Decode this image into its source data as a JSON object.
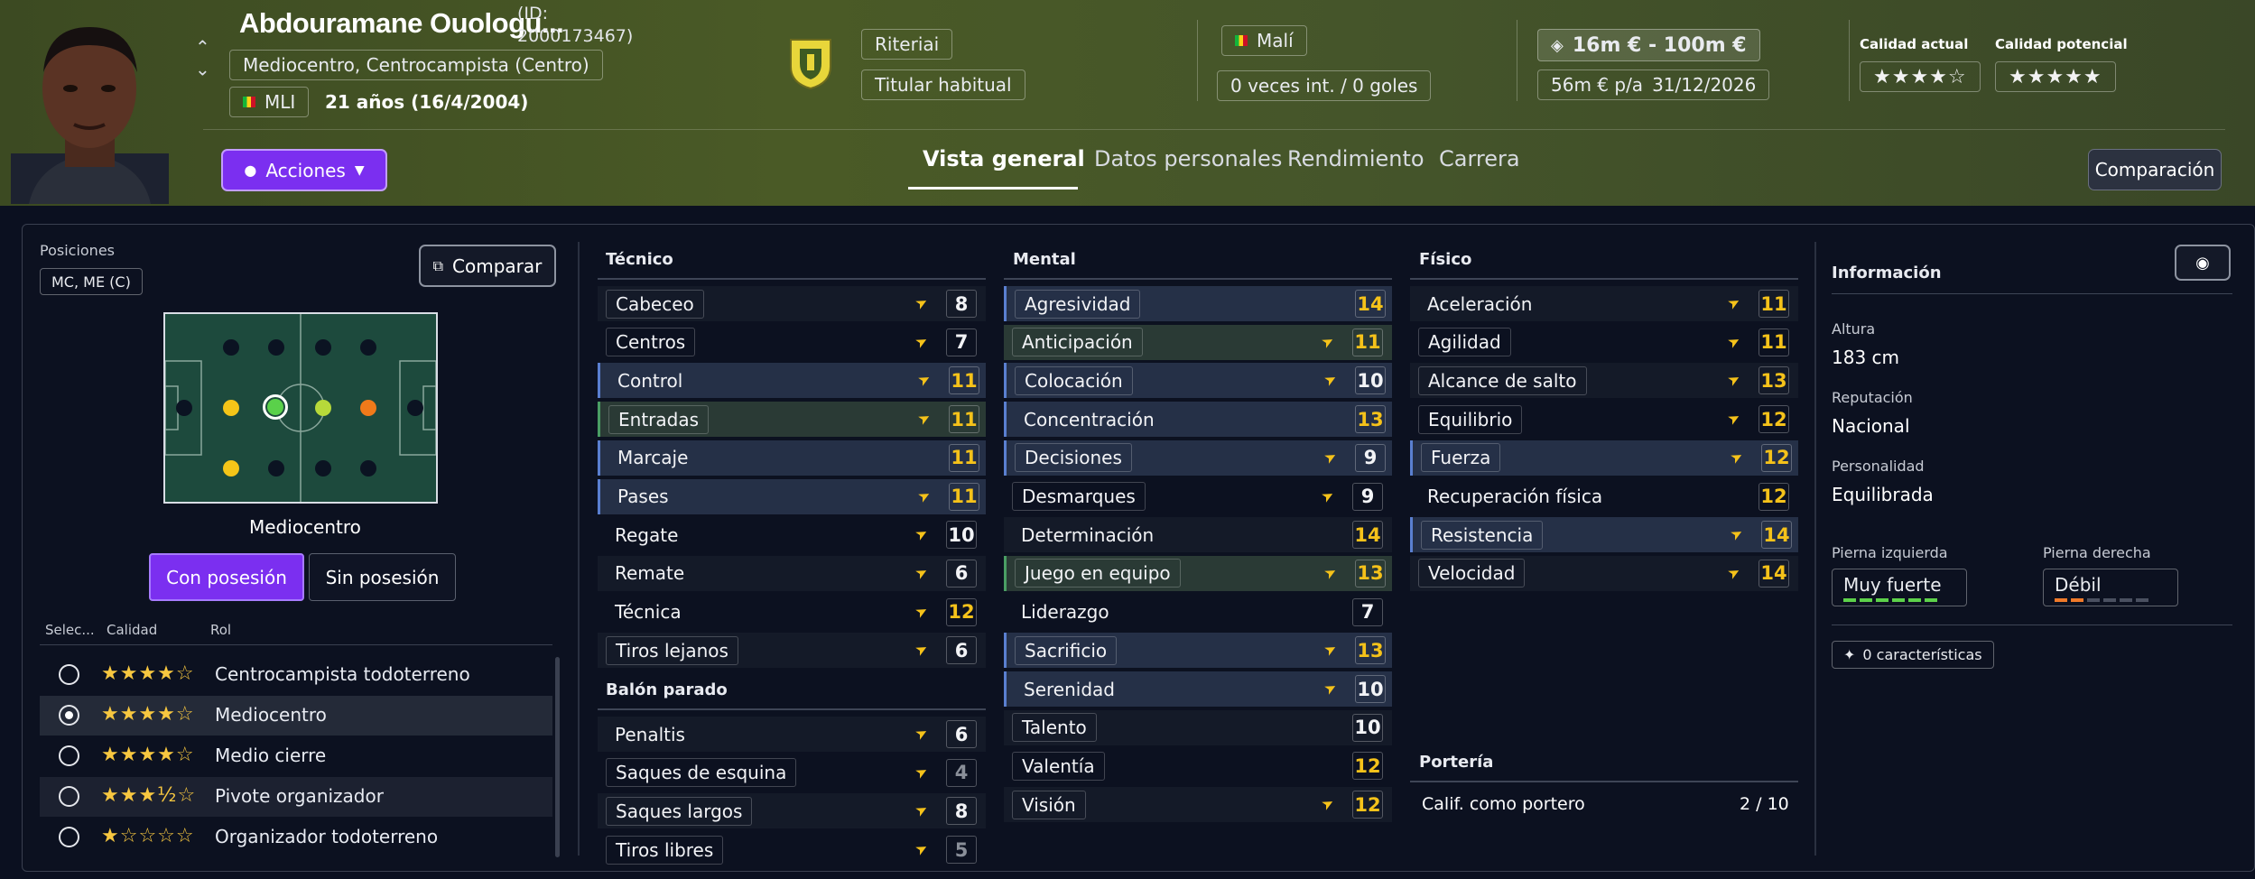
{
  "header": {
    "player_name": "Abdouramane Ouologu...",
    "player_id": "(ID: 2000173467)",
    "position_text": "Mediocentro, Centrocampista (Centro)",
    "nation_code": "MLI",
    "age_text": "21 años (16/4/2004)",
    "club": "Riteriai",
    "squad_status": "Titular habitual",
    "nationality": "Malí",
    "caps": "0 veces int. / 0 goles",
    "value_range": "16m € - 100m €",
    "wage": "56m € p/a",
    "contract_end": "31/12/2026",
    "current_ability_label": "Calidad actual",
    "current_ability_stars": "★★★★☆",
    "potential_ability_label": "Calidad potencial",
    "potential_ability_stars": "★★★★★",
    "actions_label": "Acciones",
    "compare_button": "Comparación"
  },
  "tabs": [
    "Vista general",
    "Datos personales",
    "Rendimiento",
    "Carrera"
  ],
  "positions": {
    "label": "Posiciones",
    "value": "MC, ME (C)",
    "compare_button": "Comparar",
    "role_name": "Mediocentro",
    "toggle_with": "Con posesión",
    "toggle_without": "Sin posesión",
    "col_select": "Selec...",
    "col_quality": "Calidad",
    "col_role": "Rol",
    "roles": [
      {
        "stars": "★★★★☆",
        "name": "Centrocampista todoterreno",
        "selected": false
      },
      {
        "stars": "★★★★☆",
        "name": "Mediocentro",
        "selected": true
      },
      {
        "stars": "★★★★☆",
        "name": "Medio cierre",
        "selected": false
      },
      {
        "stars": "★★★½☆",
        "name": "Pivote organizador",
        "selected": false
      },
      {
        "stars": "★☆☆☆☆",
        "name": "Organizador todoterreno",
        "selected": false
      }
    ]
  },
  "tecnico": {
    "title": "Técnico",
    "items": [
      {
        "name": "Cabeceo",
        "value": "8"
      },
      {
        "name": "Centros",
        "value": "7"
      },
      {
        "name": "Control",
        "value": "11"
      },
      {
        "name": "Entradas",
        "value": "11"
      },
      {
        "name": "Marcaje",
        "value": "11"
      },
      {
        "name": "Pases",
        "value": "11"
      },
      {
        "name": "Regate",
        "value": "10"
      },
      {
        "name": "Remate",
        "value": "6"
      },
      {
        "name": "Técnica",
        "value": "12"
      },
      {
        "name": "Tiros lejanos",
        "value": "6"
      }
    ]
  },
  "balon_parado": {
    "title": "Balón parado",
    "items": [
      {
        "name": "Penaltis",
        "value": "6"
      },
      {
        "name": "Saques de esquina",
        "value": "4"
      },
      {
        "name": "Saques largos",
        "value": "8"
      },
      {
        "name": "Tiros libres",
        "value": "5"
      }
    ]
  },
  "mental": {
    "title": "Mental",
    "items": [
      {
        "name": "Agresividad",
        "value": "14"
      },
      {
        "name": "Anticipación",
        "value": "11"
      },
      {
        "name": "Colocación",
        "value": "10"
      },
      {
        "name": "Concentración",
        "value": "13"
      },
      {
        "name": "Decisiones",
        "value": "9"
      },
      {
        "name": "Desmarques",
        "value": "9"
      },
      {
        "name": "Determinación",
        "value": "14"
      },
      {
        "name": "Juego en equipo",
        "value": "13"
      },
      {
        "name": "Liderazgo",
        "value": "7"
      },
      {
        "name": "Sacrificio",
        "value": "13"
      },
      {
        "name": "Serenidad",
        "value": "10"
      },
      {
        "name": "Talento",
        "value": "10"
      },
      {
        "name": "Valentía",
        "value": "12"
      },
      {
        "name": "Visión",
        "value": "12"
      }
    ]
  },
  "fisico": {
    "title": "Físico",
    "items": [
      {
        "name": "Aceleración",
        "value": "11"
      },
      {
        "name": "Agilidad",
        "value": "11"
      },
      {
        "name": "Alcance de salto",
        "value": "13"
      },
      {
        "name": "Equilibrio",
        "value": "12"
      },
      {
        "name": "Fuerza",
        "value": "12"
      },
      {
        "name": "Recuperación física",
        "value": "12"
      },
      {
        "name": "Resistencia",
        "value": "14"
      },
      {
        "name": "Velocidad",
        "value": "14"
      }
    ]
  },
  "porteria": {
    "title": "Portería",
    "label": "Calif. como portero",
    "value": "2 / 10"
  },
  "info": {
    "title": "Información",
    "height_label": "Altura",
    "height": "183 cm",
    "reputation_label": "Reputación",
    "reputation": "Nacional",
    "personality_label": "Personalidad",
    "personality": "Equilibrada",
    "left_foot_label": "Pierna izquierda",
    "left_foot": "Muy fuerte",
    "right_foot_label": "Pierna derecha",
    "right_foot": "Débil",
    "traits": "0 características"
  },
  "colors": {
    "accent": "#7b2ff0",
    "highlight_yellow": "#f5c21a",
    "weak_orange": "#f07a2a",
    "strong_green": "#5dd14a"
  }
}
